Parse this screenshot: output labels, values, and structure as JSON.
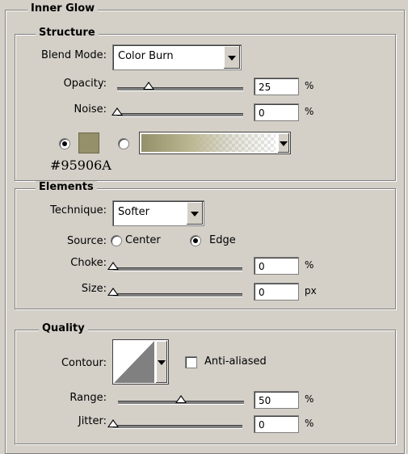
{
  "inner_glow": {
    "title": "Inner Glow",
    "structure": {
      "title": "Structure",
      "blend_mode_label": "Blend Mode:",
      "blend_mode_value": "Color Burn",
      "opacity_label": "Opacity:",
      "opacity_value": "25",
      "opacity_fraction": 0.25,
      "opacity_unit": "%",
      "noise_label": "Noise:",
      "noise_value": "0",
      "noise_fraction": 0,
      "noise_unit": "%",
      "color_hex_label": "#95906A",
      "swatch_color": "#95906A"
    },
    "elements": {
      "title": "Elements",
      "technique_label": "Technique:",
      "technique_value": "Softer",
      "source_label": "Source:",
      "source_center": "Center",
      "source_edge": "Edge",
      "choke_label": "Choke:",
      "choke_value": "0",
      "choke_fraction": 0,
      "choke_unit": "%",
      "size_label": "Size:",
      "size_value": "0",
      "size_fraction": 0,
      "size_unit": "px"
    },
    "quality": {
      "title": "Quality",
      "contour_label": "Contour:",
      "anti_aliased_label": "Anti-aliased",
      "range_label": "Range:",
      "range_value": "50",
      "range_fraction": 0.5,
      "range_unit": "%",
      "jitter_label": "Jitter:",
      "jitter_value": "0",
      "jitter_fraction": 0,
      "jitter_unit": "%"
    }
  }
}
